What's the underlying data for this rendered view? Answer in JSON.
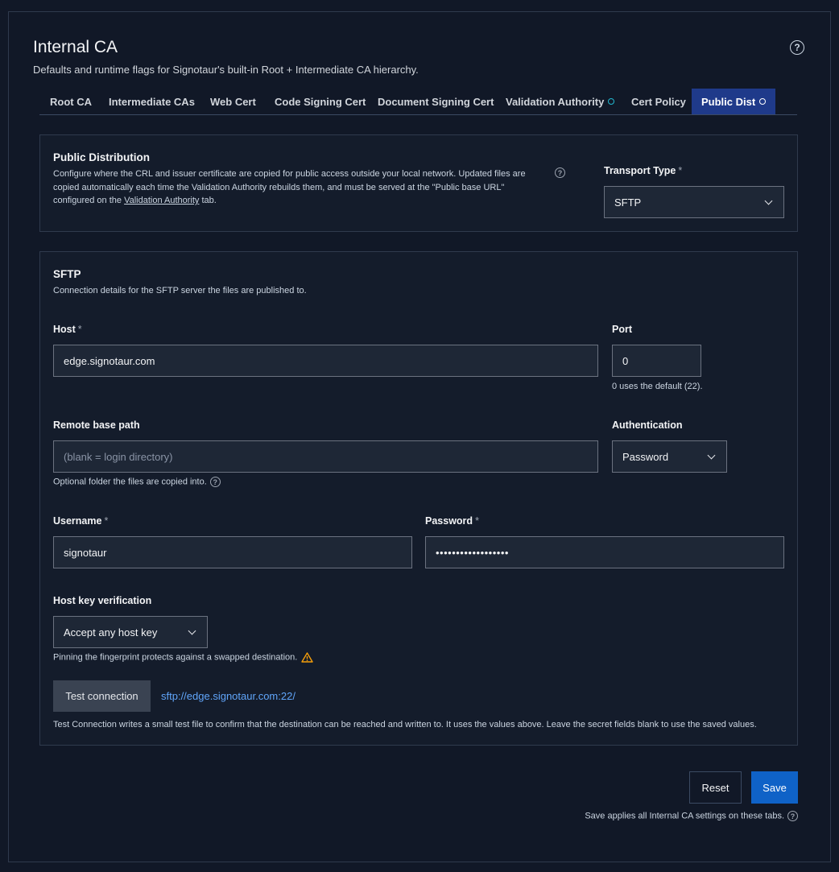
{
  "header": {
    "title": "Internal CA",
    "subtitle": "Defaults and runtime flags for Signotaur's built-in Root + Intermediate CA hierarchy.",
    "help_icon": "help-circle-icon"
  },
  "tabs": [
    {
      "label": "Root CA",
      "active": false
    },
    {
      "label": "Intermediate CAs",
      "active": false
    },
    {
      "label": "Web Cert",
      "active": false
    },
    {
      "label": "Code Signing Cert",
      "active": false
    },
    {
      "label": "Document Signing Cert",
      "active": false
    },
    {
      "label": "Validation Authority",
      "active": false,
      "indicator": "status-dot-icon"
    },
    {
      "label": "Cert Policy",
      "active": false
    },
    {
      "label": "Public Dist",
      "active": true,
      "indicator": "status-dot-icon"
    }
  ],
  "public_distribution": {
    "heading": "Public Distribution",
    "description_before": "Configure where the CRL and issuer certificate are copied for public access outside your local network. Updated files are copied automatically each time the Validation Authority rebuilds them, and must be served at the \"Public base URL\" configured on the ",
    "description_link": "Validation Authority",
    "description_after": " tab.",
    "transport_label": "Transport Type",
    "transport_value": "SFTP"
  },
  "sftp": {
    "heading": "SFTP",
    "description": "Connection details for the SFTP server the files are published to.",
    "host_label": "Host",
    "host_value": "edge.signotaur.com",
    "port_label": "Port",
    "port_value": "0",
    "port_hint": "0 uses the default (22).",
    "remote_path_label": "Remote base path",
    "remote_path_placeholder": "(blank = login directory)",
    "remote_path_hint": "Optional folder the files are copied into.",
    "auth_label": "Authentication",
    "auth_value": "Password",
    "username_label": "Username",
    "username_value": "signotaur",
    "password_label": "Password",
    "password_value": "••••••••••••••••••",
    "hostkey_label": "Host key verification",
    "hostkey_value": "Accept any host key",
    "hostkey_hint": "Pinning the fingerprint protects against a swapped destination.",
    "test_button": "Test connection",
    "test_url": "sftp://edge.signotaur.com:22/",
    "test_note": "Test Connection writes a small test file to confirm that the destination can be reached and written to. It uses the values above. Leave the secret fields blank to use the saved values."
  },
  "footer": {
    "reset_label": "Reset",
    "save_label": "Save",
    "note": "Save applies all Internal CA settings on these tabs."
  },
  "required_marker": "*",
  "help_glyph": "?",
  "colors": {
    "background": "#111827",
    "accent": "#0f62c7",
    "active_tab": "#1f3a8a",
    "link": "#60a5fa",
    "warning": "#f59e0b",
    "status_dot": "#22b8cf"
  }
}
